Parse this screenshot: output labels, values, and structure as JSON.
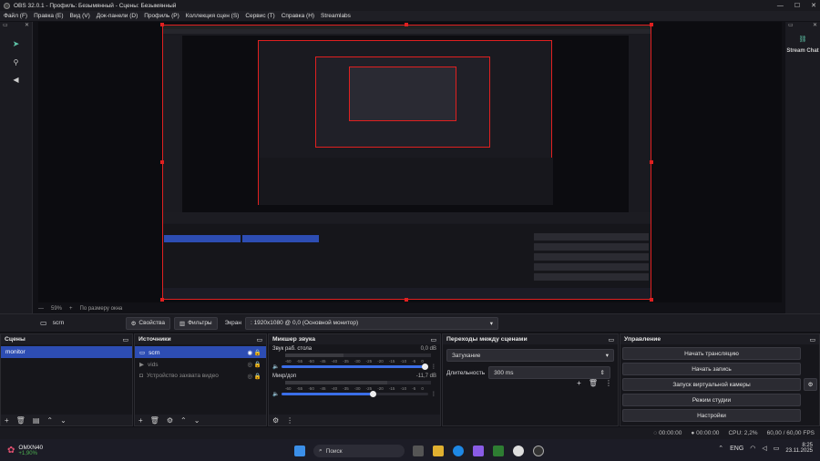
{
  "window": {
    "title": "OBS 32.0.1 - Профиль: Безымянный - Сцены: Безымянный",
    "minimize": "—",
    "maximize": "☐",
    "close": "✕"
  },
  "menu": [
    "Файл (F)",
    "Правка (E)",
    "Вид (V)",
    "Док-панели (D)",
    "Профиль (P)",
    "Коллекция сцен (S)",
    "Сервис (T)",
    "Справка (H)",
    "Streamlabs"
  ],
  "right_dock": {
    "title": "Stream Chat"
  },
  "preview_status": {
    "zoom": "59%",
    "mode": "По размеру окна"
  },
  "source_bar": {
    "source_name": "scrn",
    "properties": "Свойства",
    "filters": "Фильтры",
    "screen_label": "Экран",
    "screen_value": ": 1920x1080 @ 0,0 (Основной монитор)"
  },
  "scenes": {
    "title": "Сцены",
    "items": [
      "monitor"
    ]
  },
  "sources": {
    "title": "Источники",
    "items": [
      "scrn",
      "vids",
      "Устройство захвата видео"
    ]
  },
  "mixer": {
    "title": "Микшер звука",
    "channels": [
      {
        "name": "Звук раб. стола",
        "level": "0,0 dB",
        "volume": 1.0
      },
      {
        "name": "Микр/доп",
        "level": "-11,7 dB",
        "volume": 0.62
      }
    ],
    "ticks": [
      "-60",
      "-55",
      "-50",
      "-45",
      "-40",
      "-35",
      "-30",
      "-25",
      "-20",
      "-15",
      "-10",
      "-5",
      "0"
    ]
  },
  "transitions": {
    "title": "Переходы между сценами",
    "transition": "Затухание",
    "duration_label": "Длительность",
    "duration_value": "300 ms"
  },
  "controls": {
    "title": "Управление",
    "start_stream": "Начать трансляцию",
    "start_record": "Начать запись",
    "virtual_cam": "Запуск виртуальной камеры",
    "studio_mode": "Режим студии",
    "settings": "Настройки"
  },
  "status": {
    "stream_time": "00:00:00",
    "rec_time": "00:00:00",
    "cpu": "CPU: 2,2%",
    "fps": "60,00 / 60,00 FPS"
  },
  "taskbar": {
    "stock_name": "OMXN40",
    "stock_change": "+1,90%",
    "search": "Поиск",
    "lang": "ENG",
    "time": "8:25",
    "date": "23.11.2025"
  },
  "colors": {
    "accent": "#2d4db3",
    "selection_red": "#e02020",
    "meter_green": "#4caf50",
    "meter_blue": "#3b6ee8"
  }
}
